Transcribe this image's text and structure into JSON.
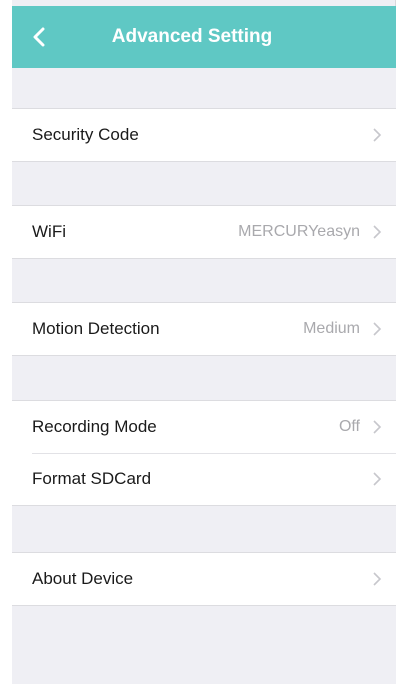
{
  "header": {
    "title": "Advanced Setting",
    "back_icon": "chevron-left-icon",
    "color": "#5fc8c4"
  },
  "items": [
    {
      "label": "Security Code",
      "value": ""
    },
    {
      "label": "WiFi",
      "value": "MERCURYeasyn"
    },
    {
      "label": "Motion Detection",
      "value": "Medium"
    },
    {
      "label": "Recording Mode",
      "value": "Off"
    },
    {
      "label": "Format SDCard",
      "value": ""
    },
    {
      "label": "About Device",
      "value": ""
    }
  ]
}
